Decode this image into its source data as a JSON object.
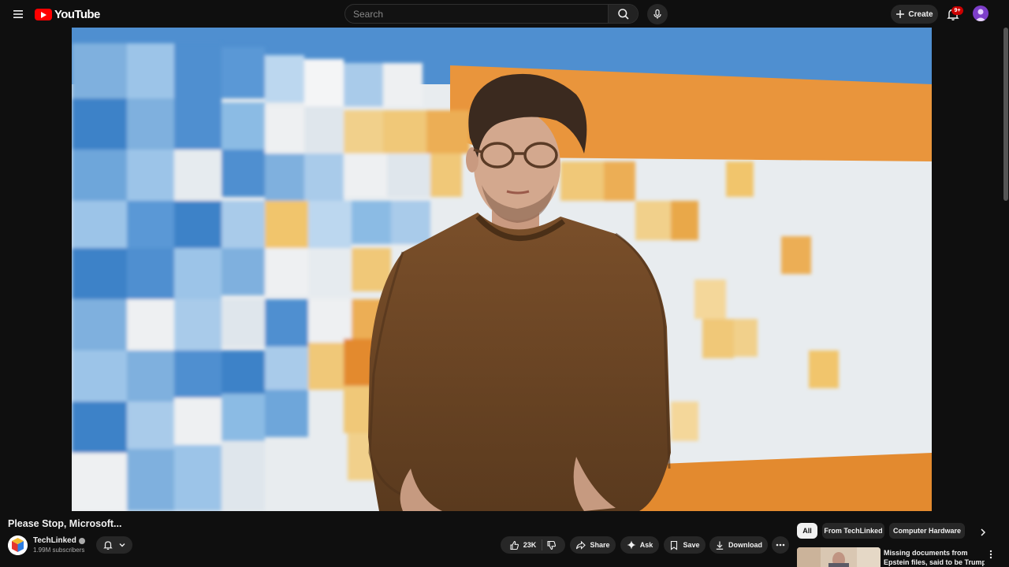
{
  "header": {
    "logo_text": "YouTube",
    "search_placeholder": "Search",
    "create_label": "Create",
    "notification_badge": "9+"
  },
  "video": {
    "title": "Please Stop, Microsoft...",
    "channel_name": "TechLinked",
    "subscribers": "1.99M subscribers",
    "likes": "23K"
  },
  "actions": {
    "share": "Share",
    "ask": "Ask",
    "save": "Save",
    "download": "Download"
  },
  "chips": [
    "All",
    "From TechLinked",
    "Computer Hardware"
  ],
  "recommendation": {
    "title_line1": "Missing documents from",
    "title_line2": "Epstein files, said to be Trump..."
  },
  "colors": {
    "background": "#0f0f0f",
    "brand_red": "#ff0000",
    "button_bg": "#272727",
    "wall_blue": "#4f8fd0",
    "wall_orange": "#e9953c",
    "sweater": "#6b4423"
  }
}
